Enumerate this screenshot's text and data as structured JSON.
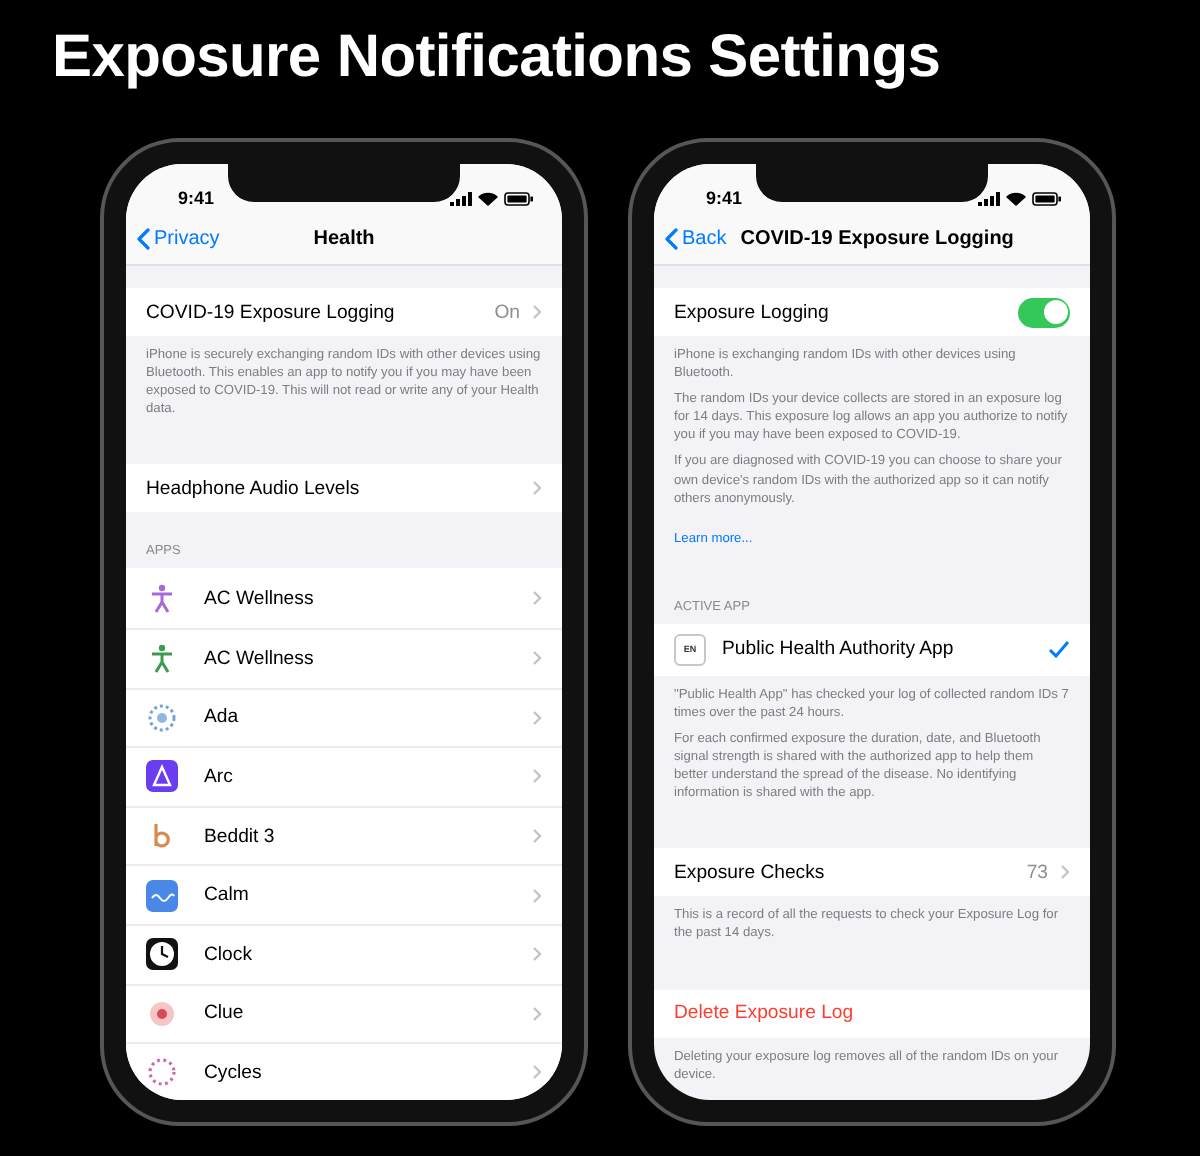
{
  "title": "Exposure Notifications Settings",
  "phones": [
    {
      "time": "9:41",
      "back": "Privacy",
      "nav_title": "Health",
      "sections": [
        {
          "rows": [
            {
              "kind": "disclosure",
              "label": "COVID-19 Exposure Logging",
              "value": "On"
            }
          ],
          "footer": [
            "iPhone is securely exchanging random IDs with other devices using Bluetooth. This enables an app to notify you if you may have been exposed to COVID-19. This will not read or write any of your Health data."
          ]
        },
        {
          "rows": [
            {
              "kind": "disclosure",
              "label": "Headphone Audio Levels"
            }
          ]
        },
        {
          "header": "APPS",
          "rows": [
            {
              "kind": "app",
              "label": "AC Wellness"
            },
            {
              "kind": "app",
              "label": "AC Wellness"
            },
            {
              "kind": "app",
              "label": "Ada"
            },
            {
              "kind": "app",
              "label": "Arc"
            },
            {
              "kind": "app",
              "label": "Beddit 3"
            },
            {
              "kind": "app",
              "label": "Calm"
            },
            {
              "kind": "app",
              "label": "Clock"
            },
            {
              "kind": "app",
              "label": "Clue"
            },
            {
              "kind": "app",
              "label": "Cycles"
            }
          ]
        }
      ]
    },
    {
      "time": "9:41",
      "back": "Back",
      "nav_title": "COVID-19 Exposure Logging",
      "sections": [
        {
          "rows": [
            {
              "kind": "toggle",
              "label": "Exposure Logging",
              "on": true
            }
          ],
          "footer": [
            "iPhone is exchanging random IDs with other devices using Bluetooth.",
            "The random IDs your device collects are stored in an exposure log for 14 days. This exposure log allows an app you authorize to notify you if you may have been exposed to COVID-19.",
            "If you are diagnosed with COVID-19 you can choose to share your own device's random IDs with the authorized app so it can notify others anonymously."
          ],
          "link": "Learn more..."
        },
        {
          "header": "ACTIVE APP",
          "rows": [
            {
              "kind": "check",
              "badge": "EN",
              "label": "Public Health Authority App",
              "checked": true
            }
          ],
          "footer": [
            "\"Public Health App\" has checked your log of collected random IDs 7 times over the past 24 hours.",
            "For each confirmed exposure the duration, date, and Bluetooth signal strength is shared with the authorized app to help them better understand the spread of the disease. No identifying information is shared with the app."
          ]
        },
        {
          "rows": [
            {
              "kind": "disclosure",
              "label": "Exposure Checks",
              "value": "73"
            }
          ],
          "footer": [
            "This is a record of all the requests to check your Exposure Log for the past 14 days."
          ]
        },
        {
          "rows": [
            {
              "kind": "destructive",
              "label": "Delete Exposure Log"
            }
          ],
          "footer": [
            "Deleting your exposure log removes all of the random IDs on your device."
          ]
        }
      ]
    }
  ]
}
